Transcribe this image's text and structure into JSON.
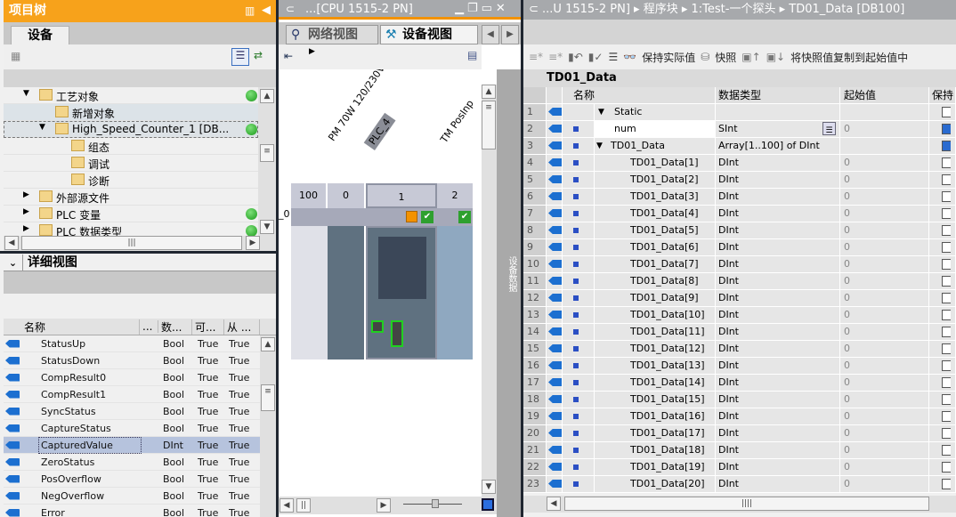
{
  "left": {
    "title": "项目树",
    "tab": "设备",
    "tree": [
      {
        "label": "工艺对象",
        "indent": 1,
        "expand": "▼",
        "status": "ok"
      },
      {
        "label": "新增对象",
        "indent": 2,
        "expand": "",
        "status": "",
        "state": "sel"
      },
      {
        "label": "High_Speed_Counter_1 [DB...",
        "indent": 2,
        "expand": "▼",
        "status": "ok",
        "state": "focus"
      },
      {
        "label": "组态",
        "indent": 3,
        "expand": "",
        "status": ""
      },
      {
        "label": "调试",
        "indent": 3,
        "expand": "",
        "status": ""
      },
      {
        "label": "诊断",
        "indent": 3,
        "expand": "",
        "status": ""
      },
      {
        "label": "外部源文件",
        "indent": 1,
        "expand": "▶",
        "status": ""
      },
      {
        "label": "PLC 变量",
        "indent": 1,
        "expand": "▶",
        "status": "ok"
      },
      {
        "label": "PLC 数据类型",
        "indent": 1,
        "expand": "▶",
        "status": "ok"
      }
    ],
    "details_title": "详细视图",
    "details_columns": [
      "名称",
      "...",
      "数...",
      "可...",
      "从 ..."
    ],
    "details_rows": [
      {
        "name": "StatusUp",
        "type": "Bool",
        "a": "True",
        "b": "True"
      },
      {
        "name": "StatusDown",
        "type": "Bool",
        "a": "True",
        "b": "True"
      },
      {
        "name": "CompResult0",
        "type": "Bool",
        "a": "True",
        "b": "True"
      },
      {
        "name": "CompResult1",
        "type": "Bool",
        "a": "True",
        "b": "True"
      },
      {
        "name": "SyncStatus",
        "type": "Bool",
        "a": "True",
        "b": "True"
      },
      {
        "name": "CaptureStatus",
        "type": "Bool",
        "a": "True",
        "b": "True"
      },
      {
        "name": "CapturedValue",
        "type": "DInt",
        "a": "True",
        "b": "True",
        "selected": true
      },
      {
        "name": "ZeroStatus",
        "type": "Bool",
        "a": "True",
        "b": "True"
      },
      {
        "name": "PosOverflow",
        "type": "Bool",
        "a": "True",
        "b": "True"
      },
      {
        "name": "NegOverflow",
        "type": "Bool",
        "a": "True",
        "b": "True"
      },
      {
        "name": "Error",
        "type": "Bool",
        "a": "True",
        "b": "True"
      }
    ]
  },
  "middle": {
    "title": "...[CPU 1515-2 PN]",
    "tabs": [
      "网络视图",
      "设备视图"
    ],
    "active_tab": 1,
    "module_labels": [
      "PM 70W 120/230V...",
      "PLC_4",
      "TM PosInp"
    ],
    "slots": [
      "100",
      "0",
      "1",
      "2"
    ],
    "rack_label": "_0",
    "side_tab": "设备数据"
  },
  "right": {
    "breadcrumb": [
      "...U 1515-2 PN]",
      "程序块",
      "1:Test-一个探头",
      "TD01_Data [DB100]"
    ],
    "toolbar": {
      "keep_actual": "保持实际值",
      "snapshot": "快照",
      "copy_snapshot": "将快照值复制到起始值中"
    },
    "block_name": "TD01_Data",
    "columns": [
      "名称",
      "数据类型",
      "起始值",
      "保持"
    ],
    "rows": [
      {
        "n": "1",
        "name": "Static",
        "type": "",
        "start": "",
        "level": 0,
        "expand": "▼",
        "retain": "none"
      },
      {
        "n": "2",
        "name": "num",
        "type": "SInt",
        "start": "0",
        "level": 1,
        "expand": "",
        "retain": "on"
      },
      {
        "n": "3",
        "name": "TD01_Data",
        "type": "Array[1..100] of DInt",
        "start": "",
        "level": 1,
        "expand": "▼",
        "retain": "on"
      },
      {
        "n": "4",
        "name": "TD01_Data[1]",
        "type": "DInt",
        "start": "0",
        "level": 2
      },
      {
        "n": "5",
        "name": "TD01_Data[2]",
        "type": "DInt",
        "start": "0",
        "level": 2
      },
      {
        "n": "6",
        "name": "TD01_Data[3]",
        "type": "DInt",
        "start": "0",
        "level": 2
      },
      {
        "n": "7",
        "name": "TD01_Data[4]",
        "type": "DInt",
        "start": "0",
        "level": 2
      },
      {
        "n": "8",
        "name": "TD01_Data[5]",
        "type": "DInt",
        "start": "0",
        "level": 2
      },
      {
        "n": "9",
        "name": "TD01_Data[6]",
        "type": "DInt",
        "start": "0",
        "level": 2
      },
      {
        "n": "10",
        "name": "TD01_Data[7]",
        "type": "DInt",
        "start": "0",
        "level": 2
      },
      {
        "n": "11",
        "name": "TD01_Data[8]",
        "type": "DInt",
        "start": "0",
        "level": 2
      },
      {
        "n": "12",
        "name": "TD01_Data[9]",
        "type": "DInt",
        "start": "0",
        "level": 2
      },
      {
        "n": "13",
        "name": "TD01_Data[10]",
        "type": "DInt",
        "start": "0",
        "level": 2
      },
      {
        "n": "14",
        "name": "TD01_Data[11]",
        "type": "DInt",
        "start": "0",
        "level": 2
      },
      {
        "n": "15",
        "name": "TD01_Data[12]",
        "type": "DInt",
        "start": "0",
        "level": 2
      },
      {
        "n": "16",
        "name": "TD01_Data[13]",
        "type": "DInt",
        "start": "0",
        "level": 2
      },
      {
        "n": "17",
        "name": "TD01_Data[14]",
        "type": "DInt",
        "start": "0",
        "level": 2
      },
      {
        "n": "18",
        "name": "TD01_Data[15]",
        "type": "DInt",
        "start": "0",
        "level": 2
      },
      {
        "n": "19",
        "name": "TD01_Data[16]",
        "type": "DInt",
        "start": "0",
        "level": 2
      },
      {
        "n": "20",
        "name": "TD01_Data[17]",
        "type": "DInt",
        "start": "0",
        "level": 2
      },
      {
        "n": "21",
        "name": "TD01_Data[18]",
        "type": "DInt",
        "start": "0",
        "level": 2
      },
      {
        "n": "22",
        "name": "TD01_Data[19]",
        "type": "DInt",
        "start": "0",
        "level": 2
      },
      {
        "n": "23",
        "name": "TD01_Data[20]",
        "type": "DInt",
        "start": "0",
        "level": 2
      }
    ]
  },
  "colors": {
    "title_orange": "#f7a21b",
    "status_ok": "#1a9a1a",
    "selection": "#b6c3dd"
  }
}
